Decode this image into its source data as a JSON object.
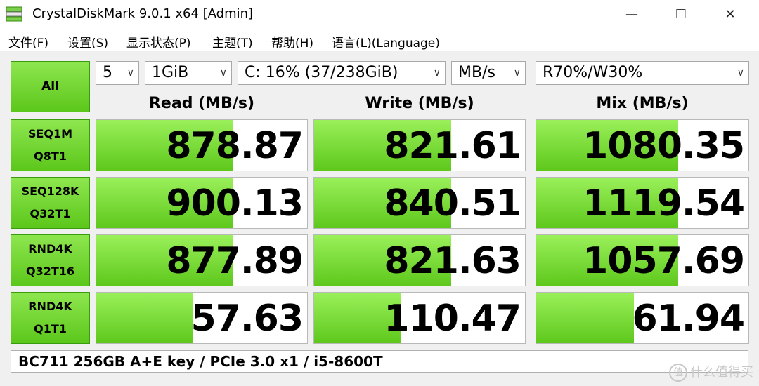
{
  "window": {
    "title": "CrystalDiskMark 9.0.1 x64 [Admin]",
    "minimize": "—",
    "maximize": "☐",
    "close": "✕"
  },
  "menu": {
    "file": "文件(F)",
    "settings": "设置(S)",
    "display": "显示状态(P)",
    "theme": "主题(T)",
    "help": "帮助(H)",
    "language": "语言(L)(Language)"
  },
  "controls": {
    "all": "All",
    "count": "5",
    "size": "1GiB",
    "drive": "C: 16% (37/238GiB)",
    "unit": "MB/s",
    "mix": "R70%/W30%",
    "arrow": "∨"
  },
  "headers": {
    "read": "Read (MB/s)",
    "write": "Write (MB/s)",
    "mix": "Mix (MB/s)"
  },
  "tests": [
    {
      "line1": "SEQ1M",
      "line2": "Q8T1",
      "read": "878.87",
      "write": "821.61",
      "mix": "1080.35",
      "read_fill": 0.65,
      "write_fill": 0.65,
      "mix_fill": 0.67
    },
    {
      "line1": "SEQ128K",
      "line2": "Q32T1",
      "read": "900.13",
      "write": "840.51",
      "mix": "1119.54",
      "read_fill": 0.65,
      "write_fill": 0.65,
      "mix_fill": 0.67
    },
    {
      "line1": "RND4K",
      "line2": "Q32T16",
      "read": "877.89",
      "write": "821.63",
      "mix": "1057.69",
      "read_fill": 0.65,
      "write_fill": 0.65,
      "mix_fill": 0.67
    },
    {
      "line1": "RND4K",
      "line2": "Q1T1",
      "read": "57.63",
      "write": "110.47",
      "mix": "61.94",
      "read_fill": 0.46,
      "write_fill": 0.41,
      "mix_fill": 0.46
    }
  ],
  "comment": "BC711 256GB A+E key / PCIe 3.0 x1 / i5-8600T",
  "watermark": "什么值得买",
  "watermark_icon": "值"
}
